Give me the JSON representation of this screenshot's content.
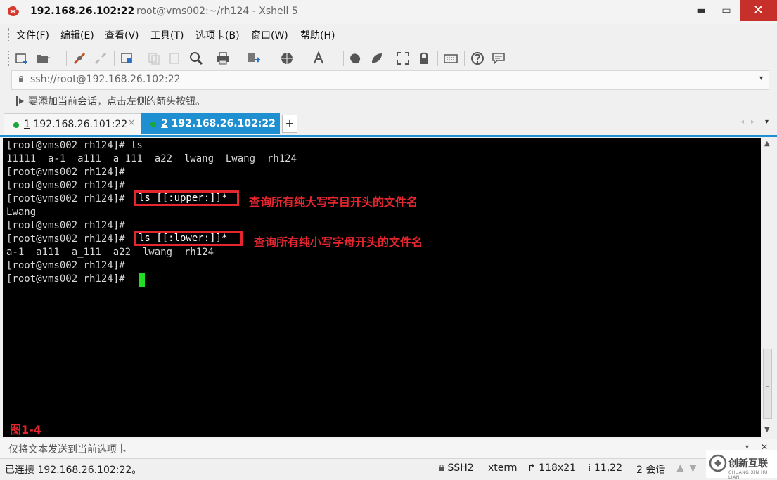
{
  "window": {
    "title_host": "192.168.26.102:22",
    "title_rest": "root@vms002:~/rh124 - Xshell 5",
    "minimize": "▬",
    "maximize": "▭",
    "close": "✕"
  },
  "menu": [
    "文件(F)",
    "编辑(E)",
    "查看(V)",
    "工具(T)",
    "选项卡(B)",
    "窗口(W)",
    "帮助(H)"
  ],
  "toolbar": {
    "icons": [
      "new-session-icon",
      "open-folder-icon",
      "connect-icon",
      "disconnect-icon",
      "properties-icon",
      "copy-icon",
      "paste-icon",
      "find-icon",
      "print-icon",
      "transfer-icon",
      "globe-icon",
      "font-icon",
      "xftp-icon",
      "xmanager-icon",
      "fullscreen-icon",
      "lock-icon",
      "keyboard-icon",
      "help-icon",
      "chat-icon"
    ]
  },
  "address": {
    "value": "ssh://root@192.168.26.102:22",
    "dropdown": "▾"
  },
  "hint": {
    "text": "要添加当前会话，点击左侧的箭头按钮。"
  },
  "tabs": [
    {
      "num": "1",
      "label": "192.168.26.101:22",
      "active": false,
      "close": "×"
    },
    {
      "num": "2",
      "label": "192.168.26.102:22",
      "active": true,
      "close": "×"
    }
  ],
  "tab_add": "+",
  "tab_scroll": {
    "prev": "◂",
    "next": "▸",
    "menu": "▾"
  },
  "terminal": {
    "lines": [
      "[root@vms002 rh124]# ls",
      "11111  a-1  a111  a_111  a22  lwang  Lwang  rh124",
      "[root@vms002 rh124]#",
      "[root@vms002 rh124]#",
      "[root@vms002 rh124]# ",
      "Lwang",
      "[root@vms002 rh124]#",
      "[root@vms002 rh124]# ",
      "a-1  a111  a_111  a22  lwang  rh124",
      "[root@vms002 rh124]#",
      "[root@vms002 rh124]# "
    ],
    "highlight1": "ls [[:upper:]]*",
    "highlight2": "ls [[:lower:]]*",
    "annotation1": "查询所有纯大写字目开头的文件名",
    "annotation2": "查询所有纯小写字母开头的文件名",
    "figure_label": "图1-4",
    "cursor_color": "#22dd22",
    "annotation_color": "#e5262f"
  },
  "scrollbar": {
    "up": "▲",
    "down": "▼"
  },
  "sendbar": {
    "text": "仅将文本发送到当前选项卡",
    "dropdown": "▾",
    "close": "✕"
  },
  "status": {
    "connection": "已连接 192.168.26.102:22。",
    "protocol": "SSH2",
    "terminal_type": "xterm",
    "size": "118x21",
    "cursor_pos": "11,22",
    "sessions": "2 会话"
  },
  "watermark": {
    "text": "创新互联",
    "sub": "CHUANG XIN HU LIAN"
  },
  "colors": {
    "tab_active": "#1e8fd0",
    "close_button": "#c7302a",
    "terminal_bg": "#000000",
    "terminal_fg": "#d8d8d8"
  }
}
